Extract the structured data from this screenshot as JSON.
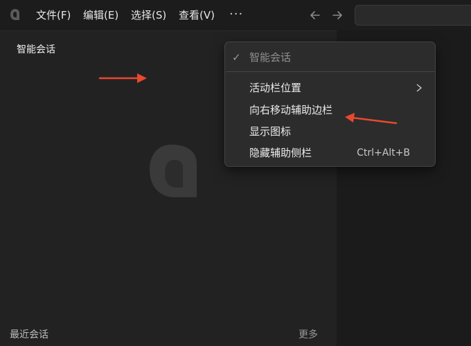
{
  "menubar": {
    "file": "文件(F)",
    "edit": "编辑(E)",
    "select": "选择(S)",
    "view": "查看(V)",
    "more": "···"
  },
  "panel": {
    "title": "智能会话",
    "recent_label": "最近会话",
    "more_label": "更多"
  },
  "context_menu": {
    "items": [
      {
        "label": "智能会话",
        "checked": true,
        "disabled": true
      },
      {
        "label": "活动栏位置",
        "submenu": true
      },
      {
        "label": "向右移动辅助边栏"
      },
      {
        "label": "显示图标"
      },
      {
        "label": "隐藏辅助侧栏",
        "shortcut": "Ctrl+Alt+B"
      }
    ]
  },
  "icons": {
    "app_logo": "app-logo-icon",
    "back": "arrow-left-icon",
    "forward": "arrow-right-icon",
    "check": "checkmark-icon",
    "chevron": "chevron-right-icon",
    "placeholder_logo": "app-logo-icon",
    "annotation_arrow": "red-arrow-icon"
  },
  "colors": {
    "annotation": "#e8492e",
    "background": "#1f1f1f",
    "menu_bg": "#2c2c2c"
  }
}
